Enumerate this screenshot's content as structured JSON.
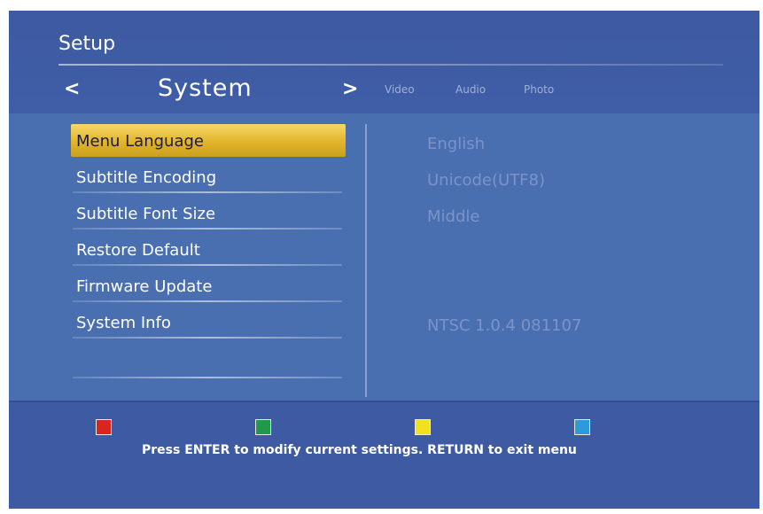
{
  "header": {
    "title": "Setup",
    "category": "System",
    "prev_arrow": "<",
    "next_arrow": ">",
    "tabs": [
      "Video",
      "Audio",
      "Photo"
    ]
  },
  "menu": {
    "selected_index": 0,
    "items": [
      {
        "label": "Menu Language",
        "value": "English"
      },
      {
        "label": "Subtitle Encoding",
        "value": "Unicode(UTF8)"
      },
      {
        "label": "Subtitle Font Size",
        "value": "Middle"
      },
      {
        "label": "Restore Default",
        "value": ""
      },
      {
        "label": "Firmware Update",
        "value": ""
      },
      {
        "label": "System Info",
        "value": "NTSC 1.0.4 081107"
      }
    ]
  },
  "footer": {
    "color_keys": [
      "red",
      "green",
      "yellow",
      "blue"
    ],
    "hint": "Press ENTER to modify current settings. RETURN to exit menu"
  },
  "colors": {
    "background": "#3d5ca4",
    "panel": "#4a6fb1",
    "highlight": "#e2b42a",
    "value_text": "#7b93c8",
    "key_red": "#d8261e",
    "key_green": "#1e9a48",
    "key_yellow": "#f2e21a",
    "key_blue": "#2b9bdc"
  }
}
